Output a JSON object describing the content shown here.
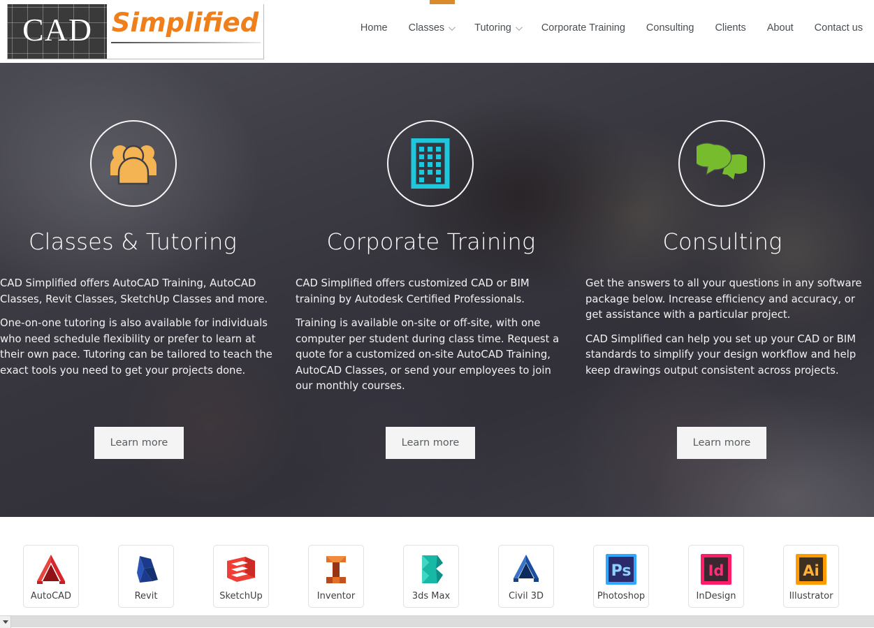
{
  "brand": {
    "logo_primary": "CAD",
    "logo_secondary": "Simplified",
    "accent_orange": "#ee7f1b",
    "logo_dark": "#3a3a3a"
  },
  "nav": {
    "items": [
      {
        "label": "Home",
        "has_dropdown": false
      },
      {
        "label": "Classes",
        "has_dropdown": true
      },
      {
        "label": "Tutoring",
        "has_dropdown": true
      },
      {
        "label": "Corporate Training",
        "has_dropdown": false
      },
      {
        "label": "Consulting",
        "has_dropdown": false
      },
      {
        "label": "Clients",
        "has_dropdown": false
      },
      {
        "label": "About",
        "has_dropdown": false
      },
      {
        "label": "Contact us",
        "has_dropdown": false
      }
    ]
  },
  "hero": {
    "columns": [
      {
        "icon": "group-people-icon",
        "icon_color": "#f5b453",
        "title": "Classes & Tutoring",
        "paragraphs": [
          "CAD Simplified offers AutoCAD Training, AutoCAD Classes, Revit Classes, SketchUp Classes and more.",
          "One-on-one tutoring is also available for individuals who need schedule flexibility or prefer to learn at their own pace.  Tutoring can be tailored to teach the exact tools you need to get your projects done."
        ],
        "button_label": "Learn more"
      },
      {
        "icon": "office-building-icon",
        "icon_color": "#1fc7dd",
        "title": "Corporate Training",
        "paragraphs": [
          "CAD Simplified offers customized CAD or BIM training by Autodesk Certified Professionals.",
          "Training is available on-site or off-site, with one computer per student during class time. Request a quote for a customized on-site AutoCAD Training, AutoCAD Classes, or send your employees to join our monthly courses."
        ],
        "button_label": "Learn more"
      },
      {
        "icon": "speech-bubbles-icon",
        "icon_color": "#76bc2d",
        "title": "Consulting",
        "paragraphs": [
          "Get the answers to all your questions in any software package below. Increase efficiency and accuracy, or get assistance with a particular project.",
          "CAD Simplified can help you set up your CAD or BIM standards to simplify your design workflow and help keep drawings output consistent across projects."
        ],
        "button_label": "Learn more"
      }
    ]
  },
  "software_strip": {
    "items": [
      {
        "label": "AutoCAD",
        "icon": "autocad-icon",
        "color": "#d6262b"
      },
      {
        "label": "Revit",
        "icon": "revit-icon",
        "color": "#1b3a8c"
      },
      {
        "label": "SketchUp",
        "icon": "sketchup-icon",
        "color": "#ef3e36"
      },
      {
        "label": "Inventor",
        "icon": "inventor-icon",
        "color": "#c0521f"
      },
      {
        "label": "3ds Max",
        "icon": "3dsmax-icon",
        "color": "#17b8a6"
      },
      {
        "label": "Civil 3D",
        "icon": "civil3d-icon",
        "color": "#1b4ea0"
      },
      {
        "label": "Photoshop",
        "icon": "photoshop-icon",
        "color": "#31a8ff"
      },
      {
        "label": "InDesign",
        "icon": "indesign-icon",
        "color": "#ff3366"
      },
      {
        "label": "Illustrator",
        "icon": "illustrator-icon",
        "color": "#ff9a00"
      }
    ]
  },
  "scrollbar": {
    "orientation": "horizontal",
    "left_arrow": "scroll-left-arrow"
  }
}
